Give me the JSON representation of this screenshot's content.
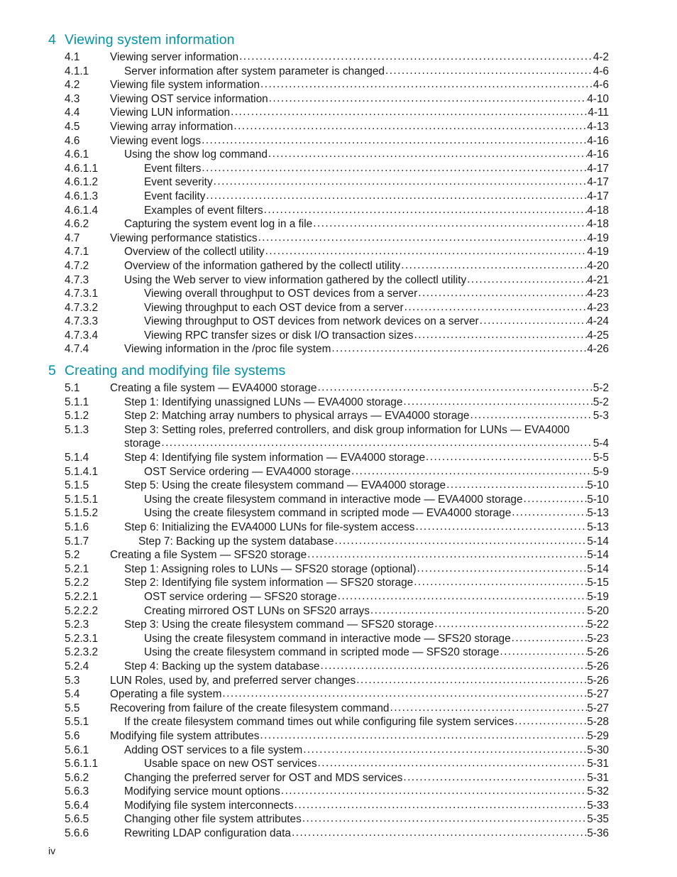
{
  "page": {
    "folio": "iv",
    "heading_color": "#0094a8",
    "text_color": "#1a1a1a"
  },
  "toc": {
    "chapters": [
      {
        "number": "4",
        "title": "Viewing system information",
        "entries": [
          {
            "level": 2,
            "number": "4.1",
            "title": "Viewing server information",
            "page": "4-2"
          },
          {
            "level": 3,
            "number": "4.1.1",
            "title": "Server information after system parameter is changed",
            "page": "4-6"
          },
          {
            "level": 2,
            "number": "4.2",
            "title": "Viewing file system information",
            "page": "4-6"
          },
          {
            "level": 2,
            "number": "4.3",
            "title": "Viewing OST service information",
            "page": "4-10"
          },
          {
            "level": 2,
            "number": "4.4",
            "title": "Viewing LUN information",
            "page": "4-11"
          },
          {
            "level": 2,
            "number": "4.5",
            "title": "Viewing array information",
            "page": "4-13"
          },
          {
            "level": 2,
            "number": "4.6",
            "title": "Viewing event logs",
            "page": "4-16"
          },
          {
            "level": 3,
            "number": "4.6.1",
            "title": "Using the show log command",
            "page": "4-16"
          },
          {
            "level": 4,
            "number": "4.6.1.1",
            "title": "Event filters",
            "page": "4-17"
          },
          {
            "level": 4,
            "number": "4.6.1.2",
            "title": "Event severity",
            "page": "4-17"
          },
          {
            "level": 4,
            "number": "4.6.1.3",
            "title": "Event facility",
            "page": "4-17"
          },
          {
            "level": 4,
            "number": "4.6.1.4",
            "title": "Examples of event filters",
            "page": "4-18"
          },
          {
            "level": 3,
            "number": "4.6.2",
            "title": "Capturing the system event log in a file",
            "page": "4-18"
          },
          {
            "level": 2,
            "number": "4.7",
            "title": "Viewing performance statistics",
            "page": "4-19"
          },
          {
            "level": 3,
            "number": "4.7.1",
            "title": "Overview of the collectl utility",
            "page": "4-19"
          },
          {
            "level": 3,
            "number": "4.7.2",
            "title": "Overview of the information gathered by the collectl utility",
            "page": "4-20"
          },
          {
            "level": 3,
            "number": "4.7.3",
            "title": "Using the Web server to view information gathered by the collectl utility",
            "page": "4-21"
          },
          {
            "level": 4,
            "number": "4.7.3.1",
            "title": "Viewing overall throughput to OST devices from a server",
            "page": "4-23"
          },
          {
            "level": 4,
            "number": "4.7.3.2",
            "title": "Viewing throughput to each OST device from a server",
            "page": "4-23"
          },
          {
            "level": 4,
            "number": "4.7.3.3",
            "title": "Viewing throughput to OST devices from network devices on a server",
            "page": "4-24"
          },
          {
            "level": 4,
            "number": "4.7.3.4",
            "title": "Viewing RPC transfer sizes or disk I/O transaction sizes",
            "page": "4-25"
          },
          {
            "level": 3,
            "number": "4.7.4",
            "title": "Viewing information in the /proc file system",
            "page": "4-26"
          }
        ]
      },
      {
        "number": "5",
        "title": "Creating and modifying file systems",
        "entries": [
          {
            "level": 2,
            "number": "5.1",
            "title": "Creating a file system — EVA4000 storage",
            "page": "5-2"
          },
          {
            "level": 3,
            "number": "5.1.1",
            "title": "Step 1: Identifying unassigned LUNs — EVA4000 storage",
            "page": "5-2"
          },
          {
            "level": 3,
            "number": "5.1.2",
            "title": "Step 2: Matching array numbers to physical arrays — EVA4000 storage",
            "page": "5-3"
          },
          {
            "level": 3,
            "number": "5.1.3",
            "title": "Step 3: Setting roles, preferred controllers, and disk group information for LUNs — EVA4000",
            "wrap": "storage",
            "page": "5-4"
          },
          {
            "level": 3,
            "number": "5.1.4",
            "title": "Step 4: Identifying file system information — EVA4000 storage",
            "page": "5-5"
          },
          {
            "level": 4,
            "number": "5.1.4.1",
            "title": "OST Service ordering — EVA4000 storage",
            "page": "5-9"
          },
          {
            "level": 3,
            "number": "5.1.5",
            "title": "Step 5: Using the create filesystem command — EVA4000 storage",
            "page": "5-10"
          },
          {
            "level": 4,
            "number": "5.1.5.1",
            "title": "Using the create filesystem command in interactive mode — EVA4000 storage",
            "page": "5-10"
          },
          {
            "level": 4,
            "number": "5.1.5.2",
            "title": "Using the create filesystem command in scripted mode — EVA4000 storage",
            "page": "5-13"
          },
          {
            "level": 3,
            "number": "5.1.6",
            "title": "Step 6: Initializing the EVA4000 LUNs for file-system access",
            "page": "5-13"
          },
          {
            "level": 3,
            "number": "5.1.7",
            "title": "Step 7: Backing up the system database",
            "page": "5-14",
            "extra_indent": true
          },
          {
            "level": 2,
            "number": "5.2",
            "title": "Creating a file System — SFS20 storage",
            "page": "5-14"
          },
          {
            "level": 3,
            "number": "5.2.1",
            "title": "Step 1: Assigning roles to LUNs — SFS20 storage (optional)",
            "page": "5-14"
          },
          {
            "level": 3,
            "number": "5.2.2",
            "title": "Step 2: Identifying file system information — SFS20 storage",
            "page": "5-15"
          },
          {
            "level": 4,
            "number": "5.2.2.1",
            "title": "OST service ordering — SFS20 storage",
            "page": "5-19"
          },
          {
            "level": 4,
            "number": "5.2.2.2",
            "title": "Creating mirrored OST LUNs on SFS20 arrays",
            "page": "5-20"
          },
          {
            "level": 3,
            "number": "5.2.3",
            "title": "Step 3: Using the create filesystem command — SFS20 storage",
            "page": "5-22"
          },
          {
            "level": 4,
            "number": "5.2.3.1",
            "title": "Using the create filesystem command in interactive mode — SFS20 storage",
            "page": "5-23"
          },
          {
            "level": 4,
            "number": "5.2.3.2",
            "title": "Using the create filesystem command in scripted mode — SFS20 storage",
            "page": "5-26"
          },
          {
            "level": 3,
            "number": "5.2.4",
            "title": "Step 4: Backing up the system database",
            "page": "5-26"
          },
          {
            "level": 2,
            "number": "5.3",
            "title": "LUN Roles, used by, and preferred server changes",
            "page": "5-26"
          },
          {
            "level": 2,
            "number": "5.4",
            "title": "Operating a file system",
            "page": "5-27"
          },
          {
            "level": 2,
            "number": "5.5",
            "title": "Recovering from failure of the create filesystem command",
            "page": "5-27"
          },
          {
            "level": 3,
            "number": "5.5.1",
            "title": "If the create filesystem command times out while configuring file system services",
            "page": "5-28",
            "slight_indent": true
          },
          {
            "level": 2,
            "number": "5.6",
            "title": "Modifying file system attributes",
            "page": "5-29"
          },
          {
            "level": 3,
            "number": "5.6.1",
            "title": "Adding OST services to a file system",
            "page": "5-30"
          },
          {
            "level": 4,
            "number": "5.6.1.1",
            "title": "Usable space on new OST services",
            "page": "5-31"
          },
          {
            "level": 3,
            "number": "5.6.2",
            "title": "Changing the preferred server for OST and MDS services",
            "page": "5-31"
          },
          {
            "level": 3,
            "number": "5.6.3",
            "title": "Modifying service mount options",
            "page": "5-32"
          },
          {
            "level": 3,
            "number": "5.6.4",
            "title": "Modifying file system interconnects",
            "page": "5-33"
          },
          {
            "level": 3,
            "number": "5.6.5",
            "title": "Changing other file system attributes",
            "page": "5-35"
          },
          {
            "level": 3,
            "number": "5.6.6",
            "title": "Rewriting LDAP configuration data",
            "page": "5-36"
          }
        ]
      }
    ]
  }
}
